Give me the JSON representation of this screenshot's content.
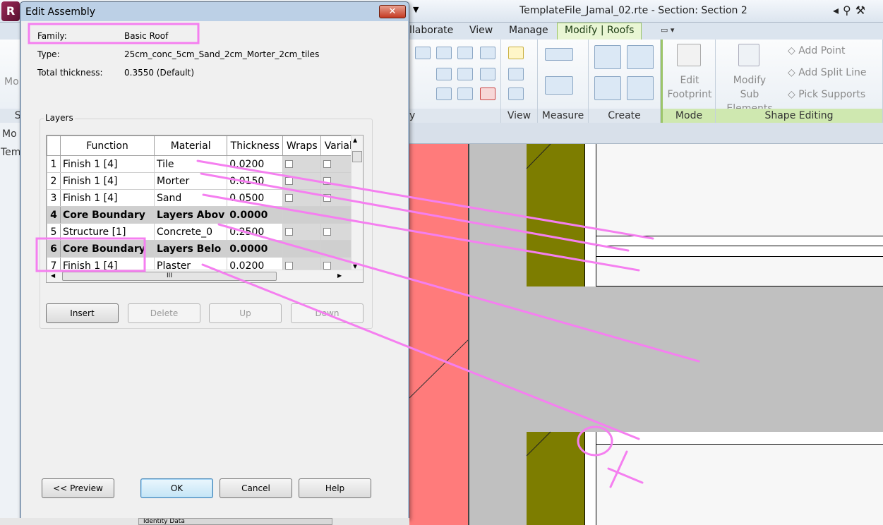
{
  "app": {
    "title": "TemplateFile_Jamal_02.rte - Section: Section 2",
    "logo": "R"
  },
  "ribbon": {
    "tabs": [
      {
        "label": "llaborate"
      },
      {
        "label": "View"
      },
      {
        "label": "Manage"
      },
      {
        "label": "Modify | Roofs",
        "active": true
      }
    ],
    "panels": {
      "view_label": "View",
      "measure_label": "Measure",
      "create_label": "Create",
      "mode_label": "Mode",
      "shape_label": "Shape Editing",
      "partial_label": "y",
      "left_label": "Se"
    },
    "edit_footprint": [
      "Edit",
      "Footprint"
    ],
    "modify_sub": [
      "Modify",
      "Sub Elements"
    ],
    "add_point": "Add Point",
    "add_split_line": "Add Split Line",
    "pick_supports": "Pick Supports",
    "left_btn": "Mo"
  },
  "side": {
    "mo": "Mo",
    "tem": "Tem"
  },
  "dialog": {
    "title": "Edit Assembly",
    "close": "✕",
    "family_label": "Family:",
    "family_value": "Basic Roof",
    "type_label": "Type:",
    "type_value": "25cm_conc_5cm_Sand_2cm_Morter_2cm_tiles",
    "thickness_label": "Total thickness:",
    "thickness_value": "0.3550 (Default)",
    "layers_title": "Layers",
    "columns": [
      "Function",
      "Material",
      "Thickness",
      "Wraps",
      "Variab"
    ],
    "rows": [
      {
        "num": "1",
        "function": "Finish 1 [4]",
        "material": "Tile",
        "thickness": "0.0200",
        "wraps": true,
        "variable": true
      },
      {
        "num": "2",
        "function": "Finish 1 [4]",
        "material": "Morter",
        "thickness": "0.0150",
        "wraps": true,
        "variable": true
      },
      {
        "num": "3",
        "function": "Finish 1 [4]",
        "material": "Sand",
        "thickness": "0.0500",
        "wraps": true,
        "variable": true
      },
      {
        "num": "4",
        "function": "Core Boundary",
        "material": "Layers Abov",
        "thickness": "0.0000",
        "boundary": true
      },
      {
        "num": "5",
        "function": "Structure [1]",
        "material": "Concrete_0",
        "thickness": "0.2500",
        "wraps": true,
        "variable": true
      },
      {
        "num": "6",
        "function": "Core Boundary",
        "material": "Layers Belo",
        "thickness": "0.0000",
        "boundary": true
      },
      {
        "num": "7",
        "function": "Finish 1 [4]",
        "material": "Plaster",
        "thickness": "0.0200",
        "wraps": true,
        "variable": true
      }
    ],
    "hscroll_thumb": "III",
    "buttons": {
      "insert": "Insert",
      "delete": "Delete",
      "up": "Up",
      "down": "Down",
      "preview": "<< Preview",
      "ok": "OK",
      "cancel": "Cancel",
      "help": "Help"
    }
  },
  "properties": {
    "identity_data": "Identity Data"
  },
  "colors": {
    "annotation": "#f57ff0",
    "insulation": "#7d7d00",
    "red_wall": "#ff7b7b",
    "concrete": "#c0c0c0"
  }
}
